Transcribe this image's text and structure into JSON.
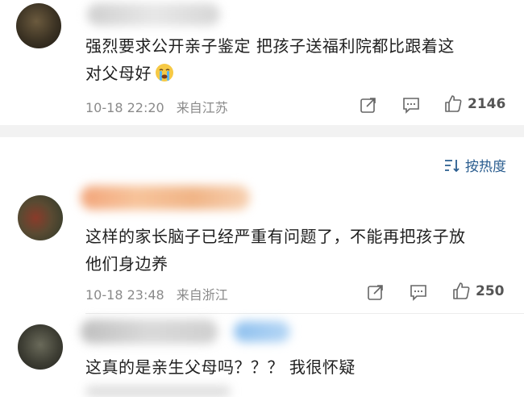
{
  "comments": [
    {
      "text_line1": "强烈要求公开亲子鉴定  把孩子送福利院都比跟着这",
      "text_line2": "对父母好",
      "emoji": "crying-face-icon",
      "date": "10-18 22:20",
      "location": "来自江苏",
      "likes": "2146"
    },
    {
      "text_line1": "这样的家长脑子已经严重有问题了，不能再把孩子放",
      "text_line2": "他们身边养",
      "date": "10-18 23:48",
      "location": "来自浙江",
      "likes": "250"
    },
    {
      "text_line1": "这真的是亲生父母吗？？？ 我很怀疑"
    }
  ],
  "sort": {
    "label": "按热度",
    "icon": "sort-icon"
  },
  "colors": {
    "accent": "#2a5d8f",
    "meta": "#8a8a8a",
    "band": "#f2f2f2"
  }
}
